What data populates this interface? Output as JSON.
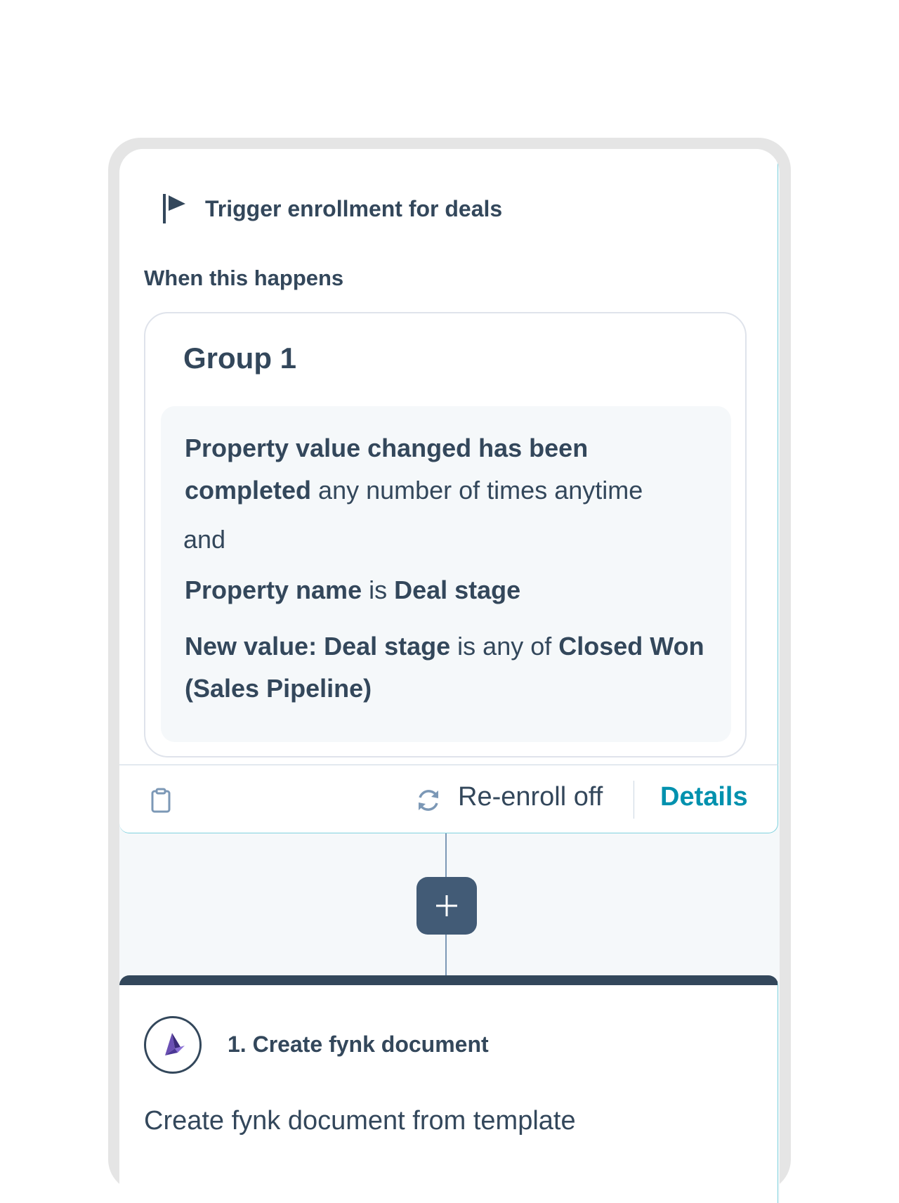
{
  "trigger": {
    "title": "Trigger enrollment for deals",
    "when_label": "When this happens",
    "group_title": "Group 1",
    "conditions": [
      {
        "bold1": "Property value changed has been completed",
        "text1": " any number of times anytime"
      },
      {
        "text": "and"
      },
      {
        "bold1": "Property name",
        "text1": " is ",
        "bold2": "Deal stage"
      },
      {
        "bold1": "New value: Deal stage",
        "text1": " is any of ",
        "bold2": "Closed Won (Sales Pipeline)"
      }
    ],
    "reenroll_label": "Re-enroll off",
    "details_label": "Details"
  },
  "action": {
    "title": "1. Create fynk document",
    "description": "Create fynk document from template"
  },
  "colors": {
    "text": "#33475b",
    "link": "#0091ae",
    "add_button": "#425b76",
    "canvas": "#f5f8fa"
  }
}
